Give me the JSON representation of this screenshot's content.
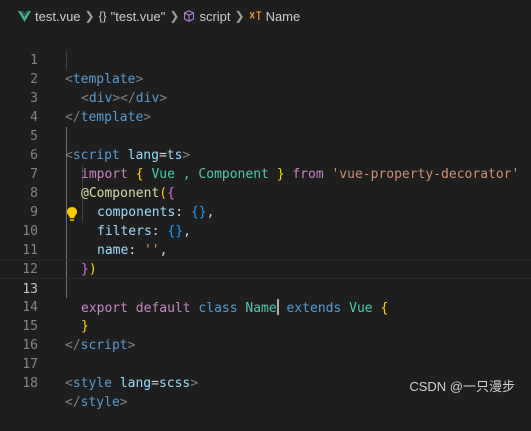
{
  "breadcrumb": {
    "file": "test.vue",
    "section": "\"test.vue\"",
    "block": "script",
    "symbol": "Name",
    "file_icon": "vue-icon",
    "section_icon": "braces-icon",
    "block_icon": "cube-icon",
    "symbol_icon": "type-parameter-icon"
  },
  "editor": {
    "current_line": 13,
    "line_numbers": [
      "1",
      "2",
      "3",
      "4",
      "5",
      "6",
      "7",
      "8",
      "9",
      "10",
      "11",
      "12",
      "13",
      "14",
      "15",
      "16",
      "17",
      "18"
    ],
    "lines": {
      "l1": [
        "<",
        "template",
        ">"
      ],
      "l2": [
        "<",
        "div",
        "></",
        "div",
        ">"
      ],
      "l3": [
        "</",
        "template",
        ">"
      ],
      "l5": [
        "<",
        "script",
        " ",
        "lang",
        "=",
        "ts",
        ">"
      ],
      "l6": [
        "import",
        " ",
        "{",
        " Vue , Component ",
        "}",
        " ",
        "from",
        " ",
        "'vue-property-decorator'"
      ],
      "l7": [
        "@Component",
        "(",
        "{"
      ],
      "l8": [
        "components",
        ": ",
        "{}",
        ","
      ],
      "l9": [
        "filters",
        ": ",
        "{}",
        ","
      ],
      "l10": [
        "name",
        ": ",
        "''",
        ","
      ],
      "l11": [
        "}",
        ")"
      ],
      "l13": [
        "export",
        " ",
        "default",
        " ",
        "class",
        " ",
        "Name",
        " ",
        "extends",
        " ",
        "Vue",
        " ",
        "{"
      ],
      "l14": [
        "}"
      ],
      "l15": [
        "</",
        "script",
        ">"
      ],
      "l17": [
        "<",
        "style",
        " ",
        "lang",
        "=",
        "scss",
        ">"
      ],
      "l18": [
        "</",
        "style",
        ">"
      ]
    },
    "lightbulb_icon": "lightbulb-icon"
  },
  "watermark": "CSDN @一只漫步",
  "colors": {
    "background": "#1e1e1e",
    "tag": "#569cd6",
    "attribute": "#9cdcfe",
    "keyword": "#c586c0",
    "class": "#4ec9b0",
    "string": "#ce9178",
    "bracket_gold": "#ffd700",
    "bracket_purple": "#da70d6",
    "bracket_blue": "#179fff",
    "line_number": "#858585"
  }
}
